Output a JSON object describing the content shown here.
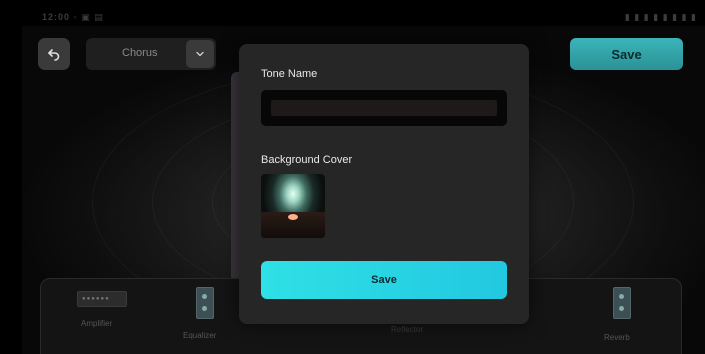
{
  "status_bar": {
    "left_text": "12:00 ◦ ▣ ▤",
    "right_text": "▮ ▮ ▮ ▮ ▮ ▮ ▮ ▮"
  },
  "header": {
    "preset_selected": "Chorus",
    "save_label": "Save"
  },
  "chain": {
    "items": [
      {
        "label": "Amplifier"
      },
      {
        "label": "Equalizer"
      },
      {
        "label": "Reflector"
      },
      {
        "label": "Reverb"
      }
    ],
    "amp_dots": "●●●●●●"
  },
  "modal": {
    "tone_name_label": "Tone Name",
    "tone_name_value": "",
    "background_cover_label": "Background Cover",
    "save_label": "Save"
  },
  "colors": {
    "accent": "#2fe0e6",
    "modal_bg": "#262626"
  }
}
